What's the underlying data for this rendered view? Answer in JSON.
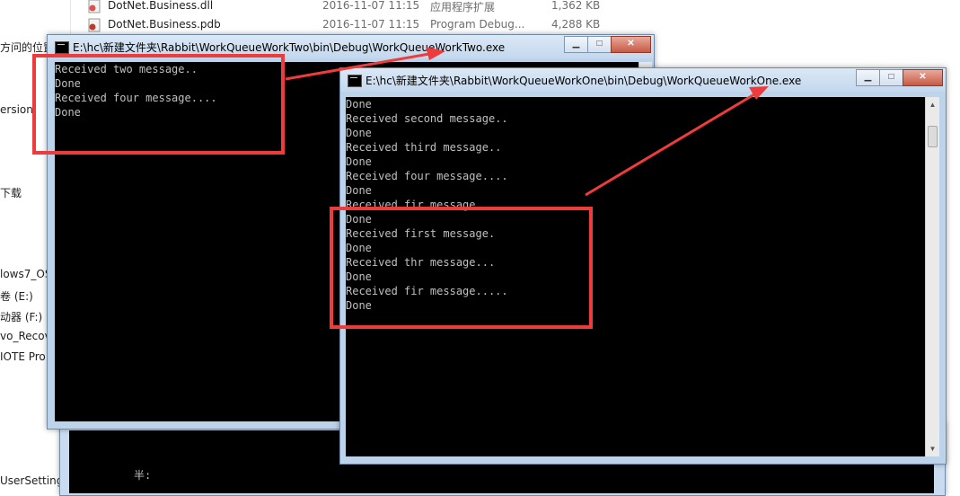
{
  "explorer": {
    "nav_items": [
      "方问的位置",
      "ersion",
      "下载",
      "lows7_OS",
      "卷 (E:)",
      "动器 (F:)",
      "vo_Recov",
      "IOTE Pro",
      "UserSetting"
    ],
    "files": [
      {
        "name": "DotNet.Business.dll",
        "date": "2016-11-07 11:15",
        "type": "应用程序扩展",
        "size": "1,362 KB"
      },
      {
        "name": "DotNet.Business.pdb",
        "date": "2016-11-07 11:15",
        "type": "Program Debug...",
        "size": "4,288 KB"
      }
    ]
  },
  "window_two": {
    "title": "E:\\hc\\新建文件夹\\Rabbit\\WorkQueueWorkTwo\\bin\\Debug\\WorkQueueWorkTwo.exe",
    "lines": [
      "Received two message..",
      "Done",
      "Received four message....",
      "Done"
    ]
  },
  "window_one": {
    "title": "E:\\hc\\新建文件夹\\Rabbit\\WorkQueueWorkOne\\bin\\Debug\\WorkQueueWorkOne.exe",
    "lines": [
      "Done",
      "Received second message..",
      "Done",
      "Received third message..",
      "Done",
      "Received four message....",
      "Done",
      "Received fir message",
      "Done",
      "Received first message.",
      "Done",
      "Received thr message...",
      "Done",
      "Received fir message.....",
      "Done"
    ]
  },
  "back_console": {
    "ime_text": "半:"
  },
  "controls": {
    "minimize": "▁",
    "maximize": "□",
    "close": "✕"
  },
  "colors": {
    "highlight": "#ee3b3b",
    "console_bg": "#000000",
    "console_text": "#c0c0c0"
  }
}
